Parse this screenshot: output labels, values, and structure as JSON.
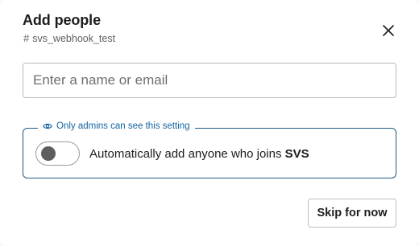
{
  "dialog": {
    "title": "Add people",
    "channel_name": "svs_webhook_test",
    "channel_icon": "hash-icon"
  },
  "search": {
    "placeholder": "Enter a name or email",
    "value": ""
  },
  "admin_setting": {
    "notice": "Only admins can see this setting",
    "notice_icon": "eye-icon",
    "toggle_label_prefix": "Automatically add anyone who joins ",
    "workspace_name": "SVS",
    "toggle_on": false
  },
  "actions": {
    "skip_label": "Skip for now"
  },
  "colors": {
    "accent": "#1264a3",
    "border_accent": "#1d5c88",
    "text": "#1d1c1d"
  }
}
